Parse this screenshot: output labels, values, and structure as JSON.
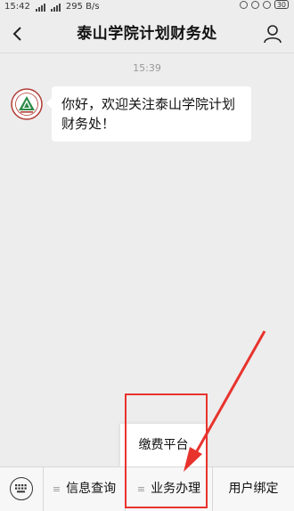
{
  "status_bar": {
    "time": "15:42",
    "network_speed": "295 B/s",
    "battery": "30"
  },
  "nav": {
    "title": "泰山学院计划财务处"
  },
  "chat": {
    "timestamp": "15:39",
    "message": "你好，欢迎关注泰山学院计划财务处！"
  },
  "popup": {
    "item": "缴费平台"
  },
  "menu": {
    "items": [
      "信息查询",
      "业务办理",
      "用户绑定"
    ]
  },
  "colors": {
    "annotation": "#e8332d"
  }
}
